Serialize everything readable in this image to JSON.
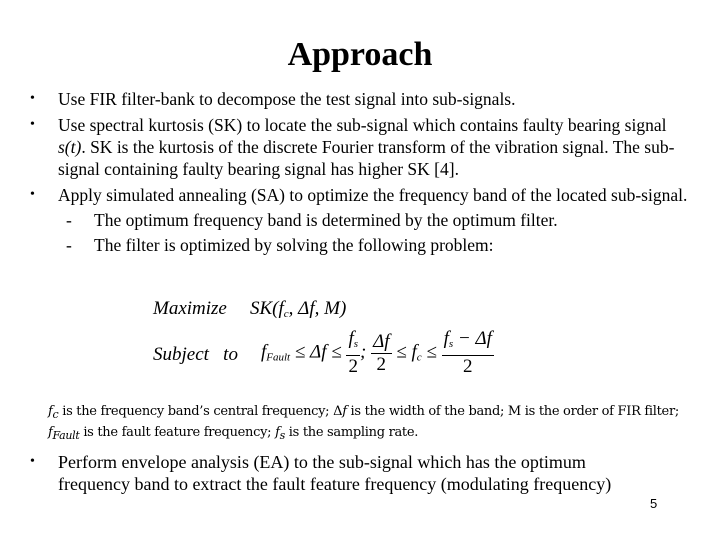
{
  "slide": {
    "title": "Approach",
    "bullets": [
      {
        "text": "Use FIR filter-bank to decompose the test signal into sub-signals."
      },
      {
        "text_line1": "Use spectral kurtosis (SK) to locate the sub-signal which contains faulty bearing signal",
        "italic": "s(t)",
        "text_line2_rest": ". SK is the kurtosis of the discrete Fourier transform of the vibration signal. The sub-",
        "text_line3": "signal containing faulty bearing signal has higher SK [4]."
      },
      {
        "text": "Apply simulated annealing (SA) to optimize the frequency band of the located sub-signal.",
        "sub_items": [
          "The optimum frequency band is determined by the optimum filter.",
          "The filter is optimized by solving the following problem:"
        ]
      }
    ],
    "bullet_symbol": "•",
    "dash_symbol": "-",
    "formula": {
      "maximize_label": "Maximize",
      "maximize_expr": "SK(f_c, Δf, M)",
      "subject_label": "Subject   to",
      "constraint": "f_Fault ≤ Δf ≤ f_s/2 ; Δf/2 ≤ f_c ≤ (f_s − Δf)/2"
    },
    "note": {
      "line1": "f_c is the frequency band’s central frequency; Δf is the width of the band; M is the order of FIR filter;",
      "line2": "f_Fault is the fault feature frequency; f_s is the sampling rate."
    },
    "last_bullet": {
      "line1": "Perform envelope analysis (EA) to the sub-signal which has the optimum",
      "line2": "frequency band to extract the fault feature frequency (modulating frequency)"
    },
    "page_number": "5"
  }
}
